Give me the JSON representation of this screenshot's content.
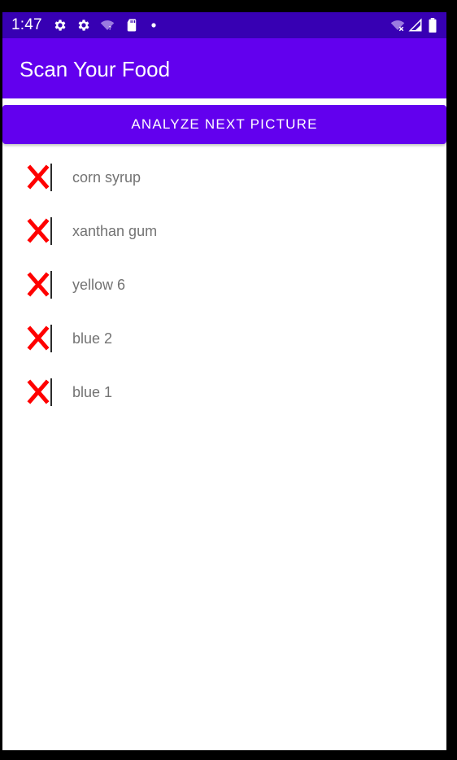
{
  "status_bar": {
    "time": "1:47",
    "icons": [
      "settings-gear-icon",
      "settings-gear-icon",
      "wifi-unknown-icon",
      "sd-card-icon",
      "notification-dot-icon",
      "wifi-no-internet-icon",
      "cell-signal-icon",
      "battery-full-icon"
    ]
  },
  "app_bar": {
    "title": "Scan Your Food",
    "color": "#6200ee",
    "status_color": "#3700b3"
  },
  "analyze_button": {
    "label": "ANALYZE NEXT PICTURE"
  },
  "ingredients": [
    {
      "name": "corn syrup",
      "status_icon": "red-x-icon"
    },
    {
      "name": "xanthan gum",
      "status_icon": "red-x-icon"
    },
    {
      "name": "yellow 6",
      "status_icon": "red-x-icon"
    },
    {
      "name": "blue 2",
      "status_icon": "red-x-icon"
    },
    {
      "name": "blue 1",
      "status_icon": "red-x-icon"
    }
  ]
}
